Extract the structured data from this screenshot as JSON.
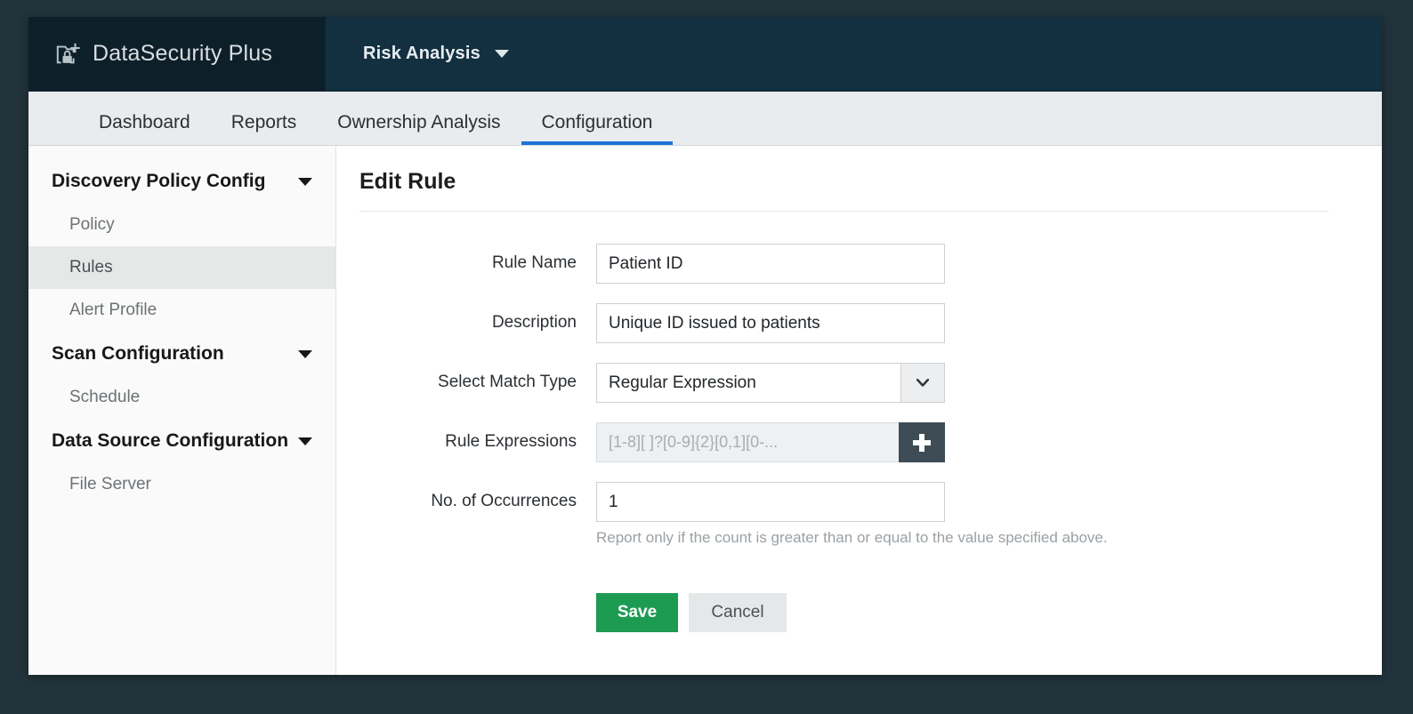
{
  "brand": {
    "logo_icon": "folder-lock-plus-icon",
    "product_name": "DataSecurity Plus",
    "module_name": "Risk Analysis",
    "module_caret_icon": "caret-down-icon"
  },
  "tabs": [
    {
      "label": "Dashboard",
      "active": false
    },
    {
      "label": "Reports",
      "active": false
    },
    {
      "label": "Ownership Analysis",
      "active": false
    },
    {
      "label": "Configuration",
      "active": true
    }
  ],
  "sidebar": {
    "groups": [
      {
        "label": "Discovery Policy Config",
        "caret_icon": "caret-down-icon",
        "items": [
          {
            "label": "Policy",
            "active": false
          },
          {
            "label": "Rules",
            "active": true
          },
          {
            "label": "Alert Profile",
            "active": false
          }
        ]
      },
      {
        "label": "Scan Configuration",
        "caret_icon": "caret-down-icon",
        "items": [
          {
            "label": "Schedule",
            "active": false
          }
        ]
      },
      {
        "label": "Data Source Configuration",
        "caret_icon": "caret-down-icon",
        "items": [
          {
            "label": "File Server",
            "active": false
          }
        ]
      }
    ]
  },
  "content": {
    "title": "Edit Rule",
    "form": {
      "rule_name": {
        "label": "Rule Name",
        "value": "Patient ID",
        "placeholder": ""
      },
      "description": {
        "label": "Description",
        "value": "Unique ID issued to patients",
        "placeholder": ""
      },
      "match_type": {
        "label": "Select Match Type",
        "value": "Regular Expression",
        "dropdown_icon": "chevron-down-icon"
      },
      "rule_expressions": {
        "label": "Rule Expressions",
        "value": "",
        "placeholder": "[1-8][ ]?[0-9]{2}[0,1][0-...",
        "add_icon": "plus-icon"
      },
      "occurrences": {
        "label": "No. of Occurrences",
        "value": "1",
        "placeholder": "",
        "help": "Report only if the count is greater than or equal to the value specified above."
      }
    },
    "actions": {
      "save_label": "Save",
      "cancel_label": "Cancel"
    }
  },
  "colors": {
    "brand_dark": "#0d2029",
    "brand_bar": "#123040",
    "tab_bar": "#e9ebee",
    "accent_blue": "#1b74d6",
    "save_green": "#1d9b53",
    "plus_button": "#3d4c55",
    "page_backdrop": "#22333b"
  }
}
